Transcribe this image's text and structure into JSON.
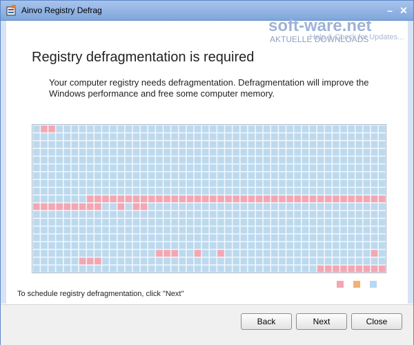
{
  "window": {
    "title": "Ainvo Registry Defrag",
    "minimize_symbol": "–",
    "close_symbol": "✕"
  },
  "watermark": {
    "main": "soft-ware.net",
    "sub": "AKTUELLE DOWNLOADS",
    "sub2": "Help & Check for Updates..."
  },
  "page": {
    "heading": "Registry defragmentation is required",
    "description": "Your computer registry needs defragmentation. Defragmentation will improve the Windows performance and free some computer memory.",
    "hint": "To schedule registry defragmentation, click \"Next\""
  },
  "legend": {
    "colors": [
      "#f4a6b3",
      "#f3b073",
      "#b8d8f0"
    ]
  },
  "grid": {
    "cols": 46,
    "rows": 19,
    "colors": {
      "empty": "#bcd9ee",
      "fragmented": "#f4a6b3"
    },
    "fragmented_cells": [
      [
        0,
        1
      ],
      [
        0,
        2
      ],
      [
        9,
        7
      ],
      [
        9,
        8
      ],
      [
        9,
        9
      ],
      [
        9,
        10
      ],
      [
        9,
        11
      ],
      [
        9,
        12
      ],
      [
        9,
        13
      ],
      [
        9,
        14
      ],
      [
        9,
        15
      ],
      [
        9,
        16
      ],
      [
        9,
        17
      ],
      [
        9,
        18
      ],
      [
        9,
        19
      ],
      [
        9,
        20
      ],
      [
        9,
        21
      ],
      [
        9,
        22
      ],
      [
        9,
        23
      ],
      [
        9,
        24
      ],
      [
        9,
        25
      ],
      [
        9,
        26
      ],
      [
        9,
        27
      ],
      [
        9,
        28
      ],
      [
        9,
        29
      ],
      [
        9,
        30
      ],
      [
        9,
        31
      ],
      [
        9,
        32
      ],
      [
        9,
        33
      ],
      [
        9,
        34
      ],
      [
        9,
        35
      ],
      [
        9,
        36
      ],
      [
        9,
        37
      ],
      [
        9,
        38
      ],
      [
        9,
        39
      ],
      [
        9,
        40
      ],
      [
        9,
        41
      ],
      [
        9,
        42
      ],
      [
        9,
        43
      ],
      [
        9,
        44
      ],
      [
        9,
        45
      ],
      [
        10,
        0
      ],
      [
        10,
        1
      ],
      [
        10,
        2
      ],
      [
        10,
        3
      ],
      [
        10,
        4
      ],
      [
        10,
        5
      ],
      [
        10,
        6
      ],
      [
        10,
        7
      ],
      [
        10,
        8
      ],
      [
        10,
        11
      ],
      [
        10,
        13
      ],
      [
        10,
        14
      ],
      [
        16,
        16
      ],
      [
        16,
        17
      ],
      [
        16,
        18
      ],
      [
        16,
        21
      ],
      [
        16,
        24
      ],
      [
        16,
        44
      ],
      [
        17,
        6
      ],
      [
        17,
        7
      ],
      [
        17,
        8
      ],
      [
        18,
        37
      ],
      [
        18,
        38
      ],
      [
        18,
        39
      ],
      [
        18,
        40
      ],
      [
        18,
        41
      ],
      [
        18,
        42
      ],
      [
        18,
        43
      ],
      [
        18,
        44
      ],
      [
        18,
        45
      ]
    ]
  },
  "buttons": {
    "back": "Back",
    "next": "Next",
    "close": "Close"
  }
}
